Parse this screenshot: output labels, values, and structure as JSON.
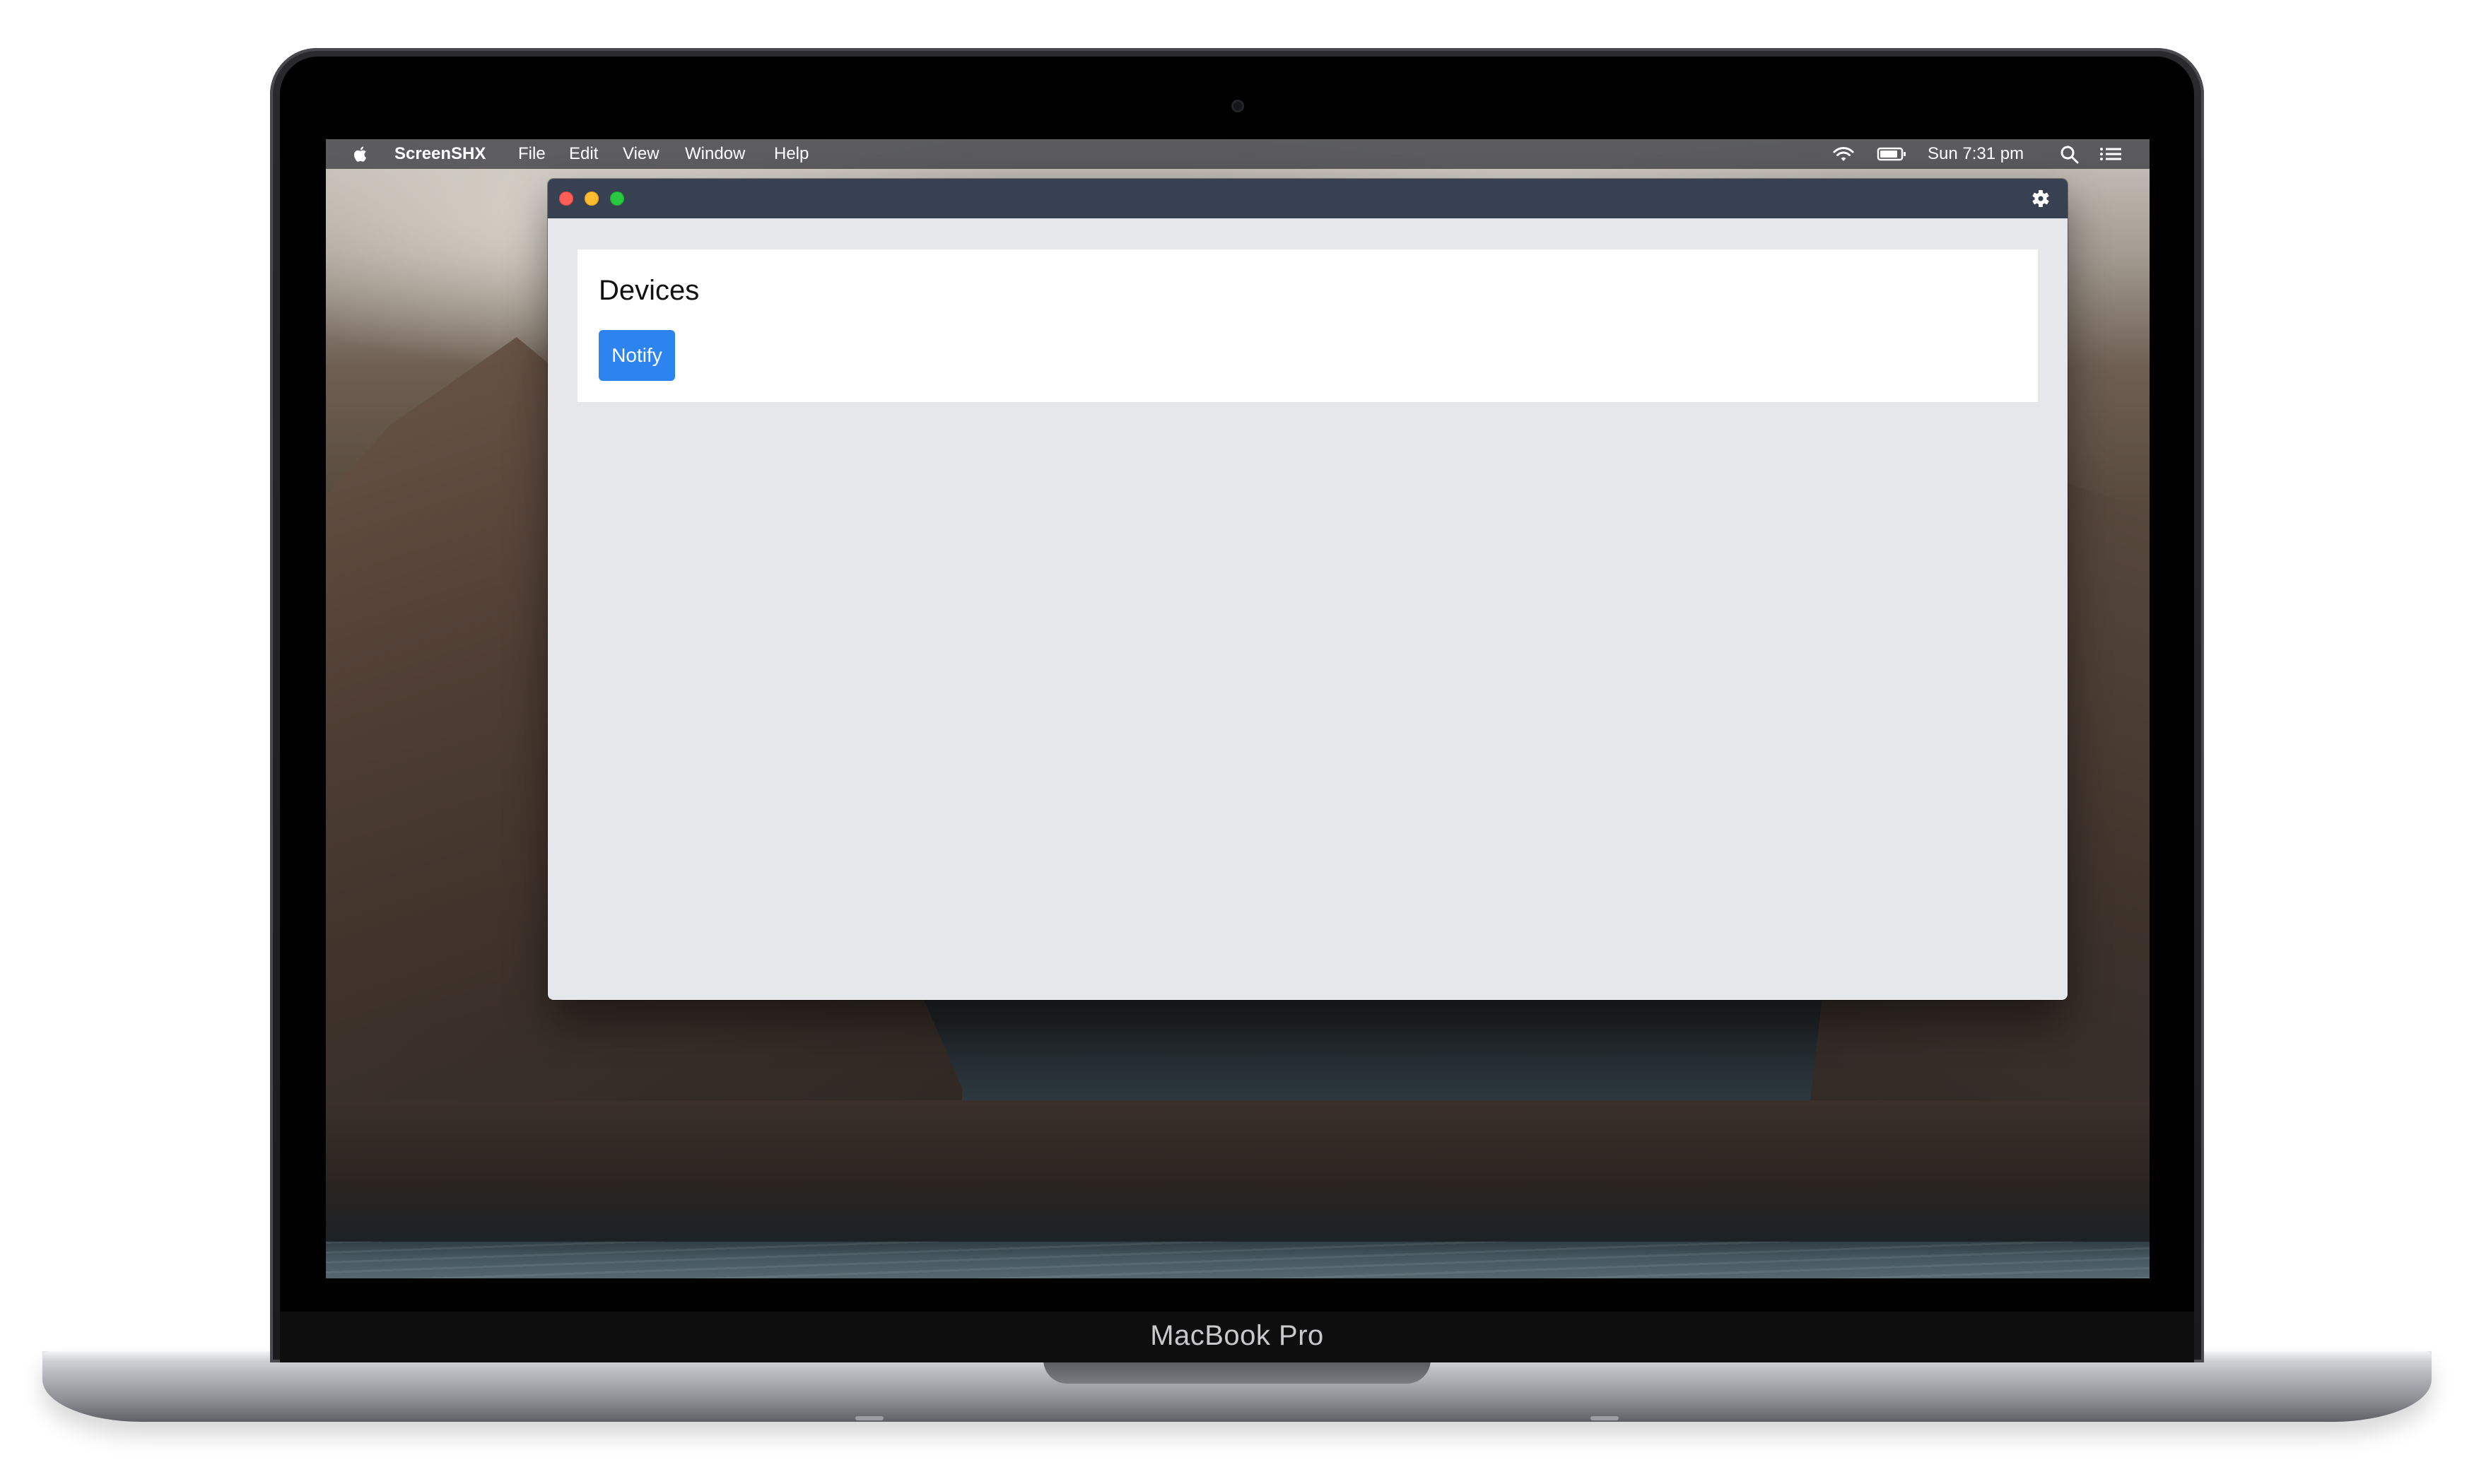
{
  "device": {
    "brand_label": "MacBook Pro"
  },
  "menubar": {
    "apple_icon": "apple-icon",
    "app_name": "ScreenSHX",
    "menus": [
      "File",
      "Edit",
      "View",
      "Window",
      "Help"
    ],
    "status_icons": [
      "wifi-icon",
      "battery-icon",
      "search-icon",
      "list-icon"
    ],
    "clock": "Sun 7:31 pm"
  },
  "window": {
    "titlebar_color": "#374151",
    "content_background": "#e5e7eb",
    "traffic_lights": {
      "close": "#ff5f57",
      "minimize": "#febc2e",
      "zoom": "#28c840"
    },
    "settings_icon": "gear-icon",
    "card": {
      "title": "Devices",
      "button_label": "Notify",
      "button_color": "#2d84f0"
    }
  }
}
